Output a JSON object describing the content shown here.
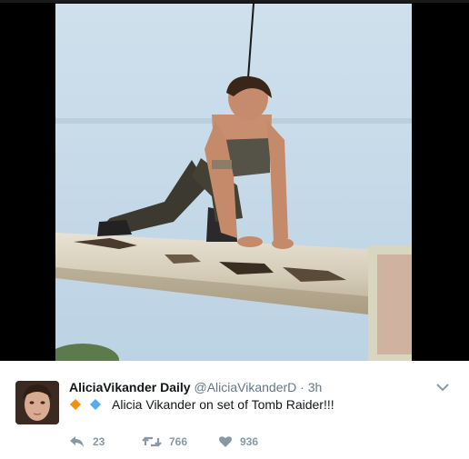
{
  "tweet": {
    "author_name": "AliciaVikander Daily",
    "handle": "@AliciaVikanderD",
    "separator": "·",
    "time": "3h",
    "text": "Alicia Vikander on set of Tomb Raider!!!",
    "emoji": [
      "orange-diamond-icon",
      "blue-diamond-icon"
    ],
    "reply_count": "23",
    "retweet_count": "766",
    "like_count": "936"
  },
  "colors": {
    "text": "#14171a",
    "secondary": "#657786",
    "action": "#8899a6",
    "orange_diamond": "#f4900c",
    "blue_diamond": "#55acee"
  }
}
